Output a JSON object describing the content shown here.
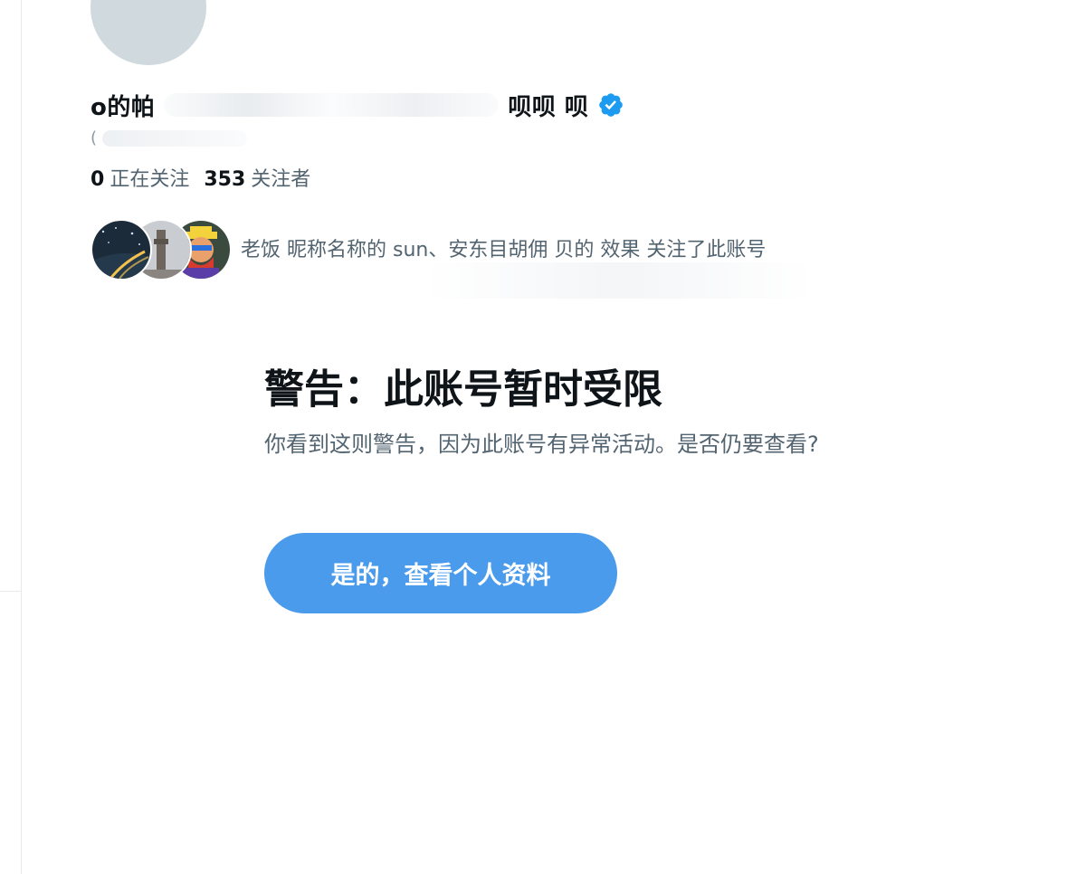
{
  "profile": {
    "display_name_start": "o的帕",
    "display_name_end": "呗呗 呗",
    "handle": "(",
    "verified_icon": "verified-badge-icon",
    "verified_color": "#1d9bf0"
  },
  "stats": {
    "following_count": "0",
    "following_label": "正在关注",
    "followers_count": "353",
    "followers_label": "关注者"
  },
  "followed_by": {
    "text": "老饭  昵称名称的    sun、安东目胡佣 贝的    效果 关注了此账号",
    "avatar_icons": [
      "starry-road-avatar-icon",
      "tower-avatar-icon",
      "cartoon-pirate-avatar-icon"
    ]
  },
  "warning": {
    "title": "警告：此账号暂时受限",
    "body": "你看到这则警告，因为此账号有异常活动。是否仍要查看?",
    "button_label": "是的，查看个人资料",
    "button_color": "#4a9beb"
  }
}
